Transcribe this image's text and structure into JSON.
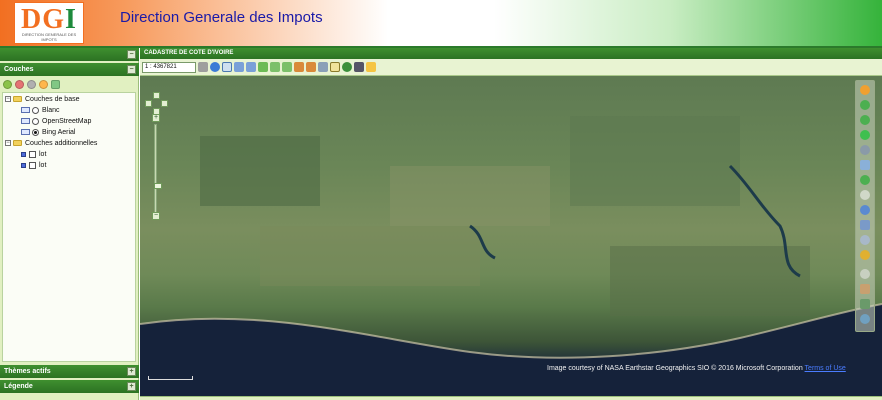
{
  "header": {
    "title": "Direction Generale des Impots",
    "logo_text_left": "DG",
    "logo_text_right": "I",
    "logo_subtext": "DIRECTION GENERALE DES IMPOTS"
  },
  "left_panel": {
    "collapse_symbol": "−",
    "couches_title": "Couches",
    "themes_title": "Thèmes actifs",
    "legende_title": "Légende",
    "expand_symbol": "+",
    "tree": {
      "base_group": "Couches de base",
      "base_layers": [
        "Blanc",
        "OpenStreetMap",
        "Bing Aerial"
      ],
      "selected_base": "Bing Aerial",
      "additional_group": "Couches additionnelles",
      "additional_layers": [
        "lot",
        "lot"
      ]
    }
  },
  "map": {
    "title": "CADASTRE DE COTE D'IVOIRE",
    "scale_value": "1 : 4367821",
    "attribution": "Image courtesy of NASA Earthstar Geographics SIO © 2016 Microsoft Corporation",
    "terms_link": "Terms of Use"
  },
  "colors": {
    "accent_green": "#2c7223",
    "panel_bg": "#e1f0c1",
    "header_orange": "#f26f21",
    "title_blue": "#1a1aa8"
  }
}
